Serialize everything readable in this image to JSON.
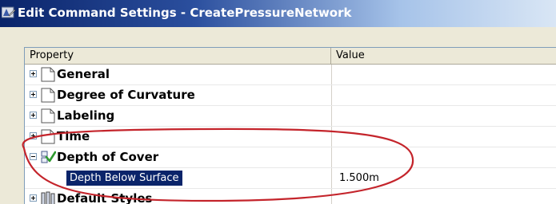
{
  "window": {
    "title": "Edit Command Settings - CreatePressureNetwork",
    "app_icon": "autocad-icon"
  },
  "grid": {
    "headers": {
      "property": "Property",
      "value": "Value"
    },
    "categories": [
      {
        "label": "General",
        "icon": "page-icon",
        "expanded": false
      },
      {
        "label": "Degree of Curvature",
        "icon": "page-icon",
        "expanded": false
      },
      {
        "label": "Labeling",
        "icon": "page-icon",
        "expanded": false
      },
      {
        "label": "Time",
        "icon": "page-icon",
        "expanded": false
      },
      {
        "label": "Depth of Cover",
        "icon": "checked-settings-icon",
        "expanded": true
      },
      {
        "label": "Default Styles",
        "icon": "styles-icon",
        "expanded": false
      }
    ],
    "selected_property": {
      "label": "Depth Below Surface",
      "value": "1.500m"
    }
  },
  "colors": {
    "selection": "#0a246a",
    "annotation_oval": "#c4242b"
  }
}
